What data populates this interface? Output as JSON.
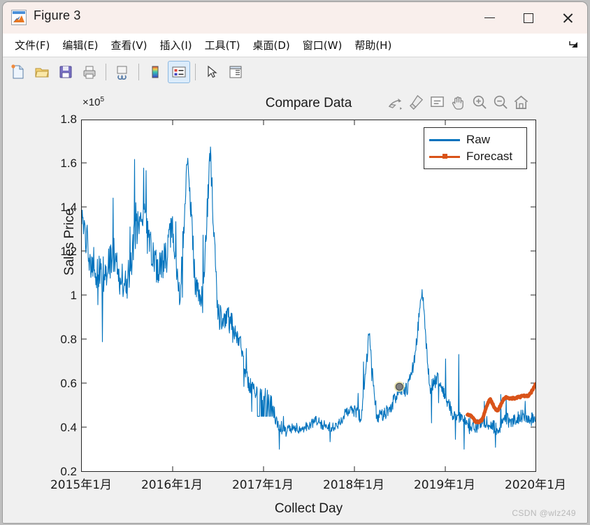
{
  "window": {
    "title": "Figure 3",
    "app_icon": "matlab-figure-icon",
    "controls": {
      "minimize": "—",
      "maximize": "☐",
      "close": "✕"
    }
  },
  "menubar": {
    "items": [
      {
        "name": "file",
        "label": "文件(F)"
      },
      {
        "name": "edit",
        "label": "编辑(E)"
      },
      {
        "name": "view",
        "label": "查看(V)"
      },
      {
        "name": "insert",
        "label": "插入(I)"
      },
      {
        "name": "tools",
        "label": "工具(T)"
      },
      {
        "name": "desktop",
        "label": "桌面(D)"
      },
      {
        "name": "window",
        "label": "窗口(W)"
      },
      {
        "name": "help",
        "label": "帮助(H)"
      }
    ],
    "undock_icon": "undock-arrow-icon"
  },
  "toolbar": {
    "buttons": [
      {
        "name": "new-figure",
        "icon": "new-document-icon"
      },
      {
        "name": "open-file",
        "icon": "open-folder-icon"
      },
      {
        "name": "save-figure",
        "icon": "floppy-save-icon"
      },
      {
        "name": "print-figure",
        "icon": "printer-icon"
      },
      {
        "name": "link-plot",
        "icon": "link-plot-icon"
      },
      {
        "name": "insert-colorbar",
        "icon": "colorbar-icon"
      },
      {
        "name": "insert-legend",
        "icon": "legend-icon",
        "active": true
      },
      {
        "name": "edit-plot",
        "icon": "arrow-pointer-icon"
      },
      {
        "name": "property-inspector",
        "icon": "property-inspector-icon"
      }
    ]
  },
  "axes_toolbar": {
    "buttons": [
      {
        "name": "export-figure",
        "icon": "export-icon"
      },
      {
        "name": "brush-data",
        "icon": "brush-icon"
      },
      {
        "name": "data-tips",
        "icon": "datatip-icon"
      },
      {
        "name": "pan",
        "icon": "pan-hand-icon"
      },
      {
        "name": "zoom-in",
        "icon": "zoom-in-icon"
      },
      {
        "name": "zoom-out",
        "icon": "zoom-out-icon"
      },
      {
        "name": "restore-view",
        "icon": "home-icon"
      }
    ]
  },
  "colors": {
    "raw": "#0072BD",
    "forecast": "#D95319",
    "axes": "#262626",
    "figure_bg": "#F0F0F0",
    "plot_bg": "#FFFFFF",
    "titlebar_bg": "#F9EFEC",
    "datatip_marker": "#808080"
  },
  "watermark": "CSDN @wlz249",
  "chart_data": {
    "type": "line",
    "title": "Compare Data",
    "xlabel": "Collect Day",
    "ylabel": "Sales Price",
    "y_exponent_label": "×10",
    "y_exponent": "5",
    "y_scale": 100000,
    "ylim": [
      0.2,
      1.8
    ],
    "yticks": [
      0.2,
      0.4,
      0.6,
      0.8,
      1,
      1.2,
      1.4,
      1.6,
      1.8
    ],
    "ytick_labels": [
      "0.2",
      "0.4",
      "0.6",
      "0.8",
      "1",
      "1.2",
      "1.4",
      "1.6",
      "1.8"
    ],
    "xlim": [
      "2015-01",
      "2020-01"
    ],
    "xticks": [
      "2015-01",
      "2016-01",
      "2017-01",
      "2018-01",
      "2019-01",
      "2020-01"
    ],
    "xtick_labels": [
      "2015年1月",
      "2016年1月",
      "2017年1月",
      "2018年1月",
      "2019年1月",
      "2020年1月"
    ],
    "grid": false,
    "legend_position": "top-right",
    "annotations": [
      {
        "name": "data-tip-marker",
        "x": "2018-07",
        "y": 0.585,
        "marker": "circle",
        "color": "#808080"
      }
    ],
    "series": [
      {
        "name": "Raw",
        "color": "#0072BD",
        "linewidth": 1,
        "description": "Daily sales price, highly volatile in 2015 (0.85-1.66e5) declining through 2016 to a ~0.4e5 plateau, with sporadic spikes through 2017-2019 and a final range of 0.35-0.5e5.",
        "x": [
          "2015-01",
          "2015-02",
          "2015-03",
          "2015-04",
          "2015-05",
          "2015-06",
          "2015-07",
          "2015-08",
          "2015-09",
          "2015-10",
          "2015-11",
          "2015-12",
          "2016-01",
          "2016-02",
          "2016-03",
          "2016-04",
          "2016-05",
          "2016-06",
          "2016-07",
          "2016-08",
          "2016-09",
          "2016-10",
          "2016-11",
          "2016-12",
          "2017-01",
          "2017-02",
          "2017-03",
          "2017-04",
          "2017-05",
          "2017-06",
          "2017-07",
          "2017-08",
          "2017-09",
          "2017-10",
          "2017-11",
          "2017-12",
          "2018-01",
          "2018-02",
          "2018-03",
          "2018-04",
          "2018-05",
          "2018-06",
          "2018-07",
          "2018-08",
          "2018-09",
          "2018-10",
          "2018-11",
          "2018-12",
          "2019-01",
          "2019-02",
          "2019-03",
          "2019-04",
          "2019-05",
          "2019-06",
          "2019-07",
          "2019-08",
          "2019-09",
          "2019-10",
          "2019-11",
          "2019-12"
        ],
        "y": [
          1.4,
          1.18,
          1.12,
          1.1,
          1.16,
          1.08,
          1.05,
          1.26,
          1.38,
          1.22,
          1.1,
          1.16,
          1.3,
          1.0,
          1.66,
          1.04,
          0.98,
          1.66,
          0.9,
          0.92,
          0.85,
          0.78,
          0.6,
          0.56,
          0.55,
          0.53,
          0.4,
          0.38,
          0.4,
          0.39,
          0.41,
          0.43,
          0.41,
          0.4,
          0.42,
          0.47,
          0.48,
          0.44,
          0.83,
          0.45,
          0.46,
          0.5,
          0.58,
          0.57,
          0.7,
          1.04,
          0.58,
          0.62,
          0.55,
          0.46,
          0.44,
          0.42,
          0.4,
          0.43,
          0.41,
          0.39,
          0.44,
          0.42,
          0.45,
          0.44
        ]
      },
      {
        "name": "Forecast",
        "color": "#D95319",
        "linewidth": 5,
        "marker": "square",
        "description": "Forecast begins around 2019-04 near 0.44e5 and rises steadily with minor oscillation to about 0.59e5 by 2020-01.",
        "x": [
          "2019-04",
          "2019-05",
          "2019-06",
          "2019-07",
          "2019-08",
          "2019-09",
          "2019-10",
          "2019-11",
          "2019-12",
          "2020-01"
        ],
        "y": [
          0.455,
          0.425,
          0.445,
          0.52,
          0.485,
          0.525,
          0.545,
          0.525,
          0.555,
          0.585
        ]
      }
    ]
  }
}
